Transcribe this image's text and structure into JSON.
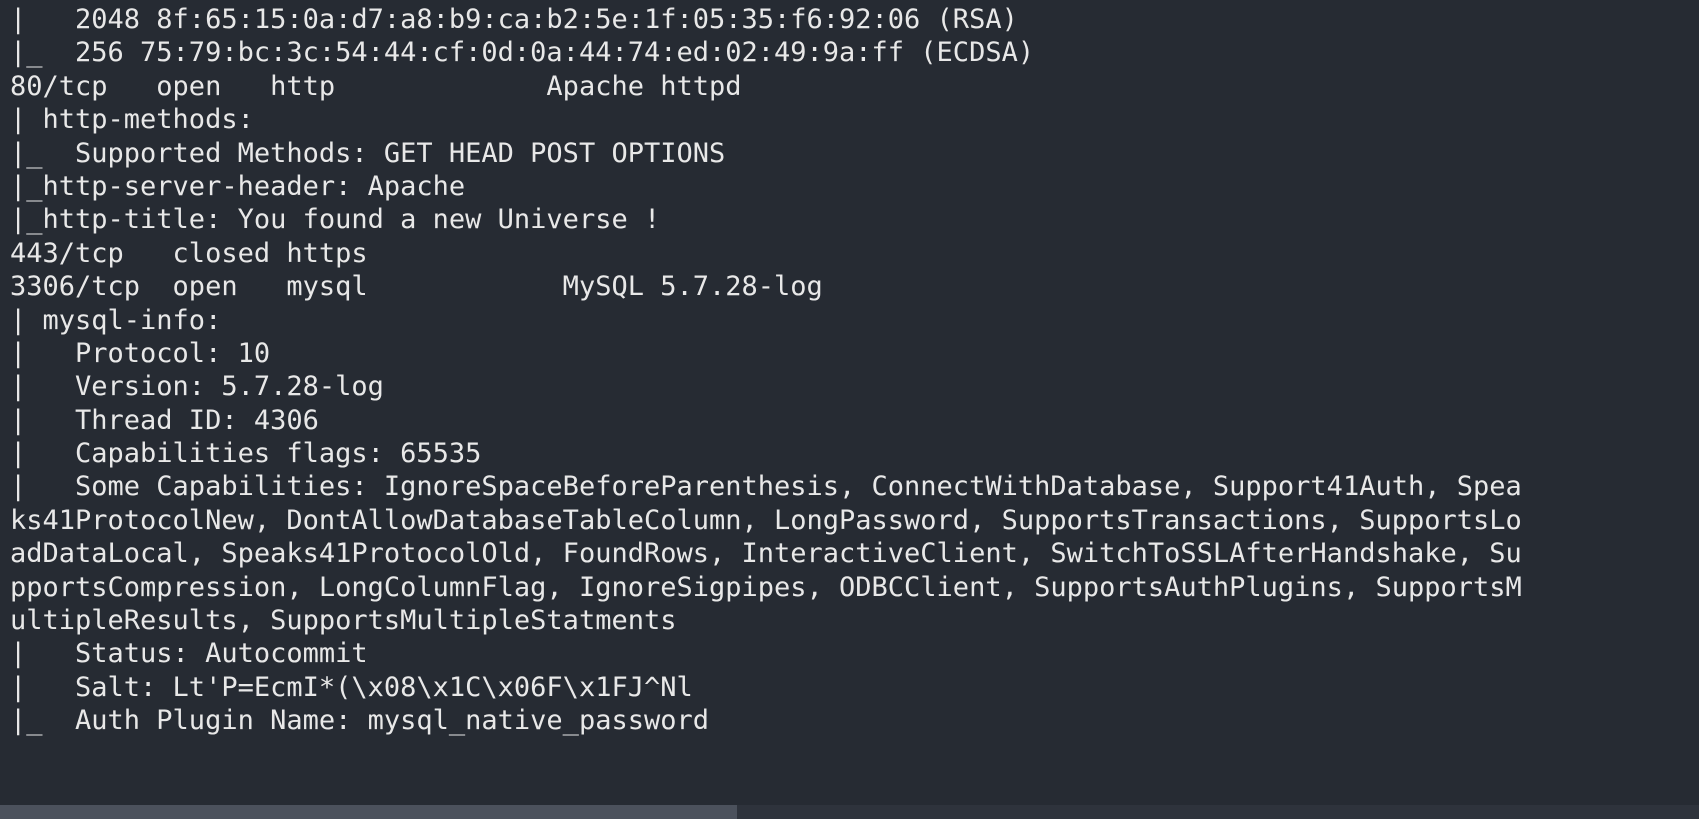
{
  "terminal": {
    "title": "nmap-scan-output",
    "background_color": "#262b33",
    "text_color": "#e8e8e8",
    "scrollbar_color": "#4b515c",
    "scrollbar_track_color": "#2e333c",
    "lines": [
      "|   2048 8f:65:15:0a:d7:a8:b9:ca:b2:5e:1f:05:35:f6:92:06 (RSA)",
      "|_  256 75:79:bc:3c:54:44:cf:0d:0a:44:74:ed:02:49:9a:ff (ECDSA)",
      "80/tcp   open   http             Apache httpd",
      "| http-methods:",
      "|_  Supported Methods: GET HEAD POST OPTIONS",
      "|_http-server-header: Apache",
      "|_http-title: You found a new Universe !",
      "443/tcp   closed https",
      "3306/tcp  open   mysql            MySQL 5.7.28-log",
      "| mysql-info:",
      "|   Protocol: 10",
      "|   Version: 5.7.28-log",
      "|   Thread ID: 4306",
      "|   Capabilities flags: 65535",
      "|   Some Capabilities: IgnoreSpaceBeforeParenthesis, ConnectWithDatabase, Support41Auth, Spea",
      "ks41ProtocolNew, DontAllowDatabaseTableColumn, LongPassword, SupportsTransactions, SupportsLo",
      "adDataLocal, Speaks41ProtocolOld, FoundRows, InteractiveClient, SwitchToSSLAfterHandshake, Su",
      "pportsCompression, LongColumnFlag, IgnoreSigpipes, ODBCClient, SupportsAuthPlugins, SupportsM",
      "ultipleResults, SupportsMultipleStatments",
      "|   Status: Autocommit",
      "|   Salt: Lt'P=EcmI*(\\x08\\x1C\\x06F\\x1FJ^Nl",
      "|_  Auth Plugin Name: mysql_native_password"
    ]
  }
}
